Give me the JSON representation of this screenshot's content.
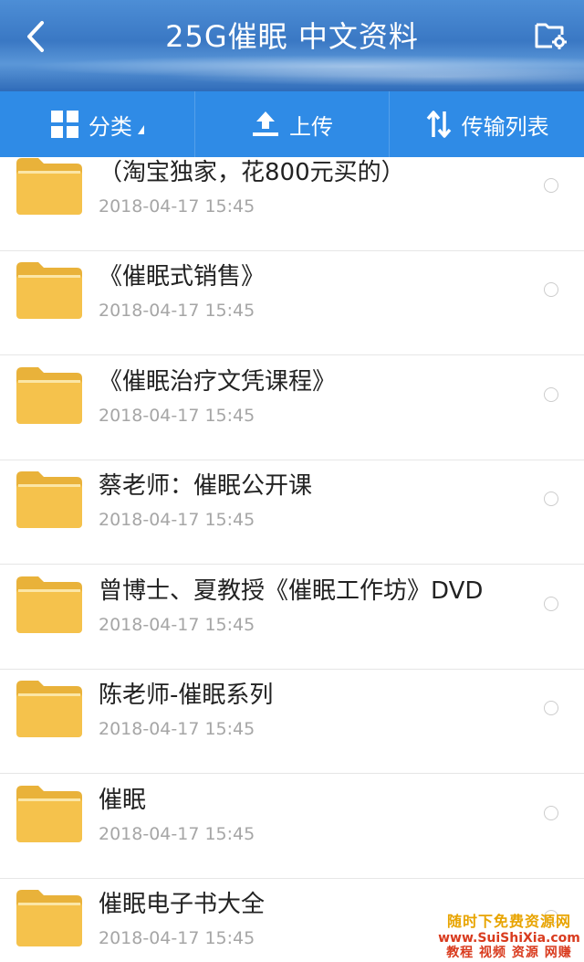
{
  "header": {
    "title": "25G催眠 中文资料",
    "back_icon": "chevron-left-icon",
    "action_icon": "folder-settings-icon"
  },
  "toolbar": {
    "category_label": "分类",
    "upload_label": "上传",
    "transfer_label": "传输列表"
  },
  "files": [
    {
      "name": "（淘宝独家，花800元买的）",
      "date": "2018-04-17  15:45"
    },
    {
      "name": "《催眠式销售》",
      "date": "2018-04-17  15:45"
    },
    {
      "name": "《催眠治疗文凭课程》",
      "date": "2018-04-17  15:45"
    },
    {
      "name": "蔡老师：催眠公开课",
      "date": "2018-04-17  15:45"
    },
    {
      "name": "曾博士、夏教授《催眠工作坊》DVD",
      "date": "2018-04-17  15:45"
    },
    {
      "name": "陈老师-催眠系列",
      "date": "2018-04-17  15:45"
    },
    {
      "name": "催眠",
      "date": "2018-04-17  15:45"
    },
    {
      "name": "催眠电子书大全",
      "date": "2018-04-17  15:45"
    }
  ],
  "watermark": {
    "line1": "随时下免费资源网",
    "line2": "www.SuiShiXia.com",
    "line3": "教程 视频 资源 网赚"
  },
  "colors": {
    "toolbar": "#2f8be6",
    "folder": "#f5c24c",
    "date": "#a6a6a6"
  }
}
